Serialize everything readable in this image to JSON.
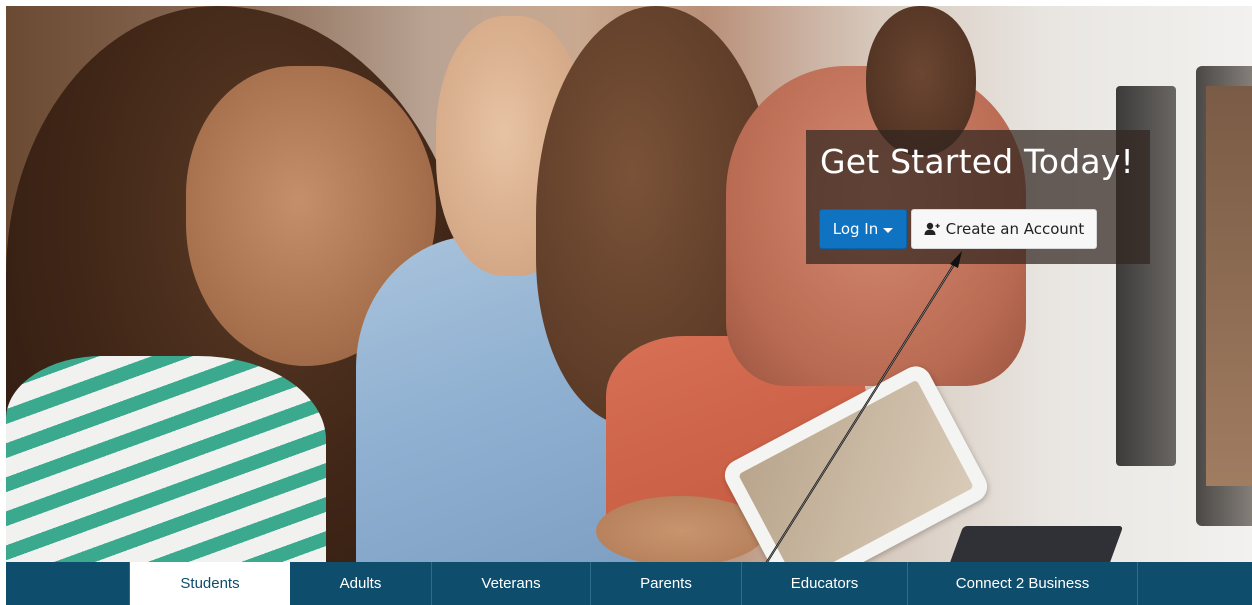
{
  "hero": {
    "cta_title": "Get Started Today!",
    "login_label": "Log In",
    "create_account_label": "Create an Account",
    "login_icon": "caret-down-icon",
    "create_account_icon": "user-plus-icon"
  },
  "nav": {
    "items": [
      {
        "label": "Students",
        "active": true
      },
      {
        "label": "Adults",
        "active": false
      },
      {
        "label": "Veterans",
        "active": false
      },
      {
        "label": "Parents",
        "active": false
      },
      {
        "label": "Educators",
        "active": false
      },
      {
        "label": "Connect 2 Business",
        "active": false
      }
    ]
  },
  "colors": {
    "nav_bg": "#0e4d6c",
    "login_bg": "#0f73c2",
    "panel_bg": "rgba(50,38,32,0.72)"
  }
}
